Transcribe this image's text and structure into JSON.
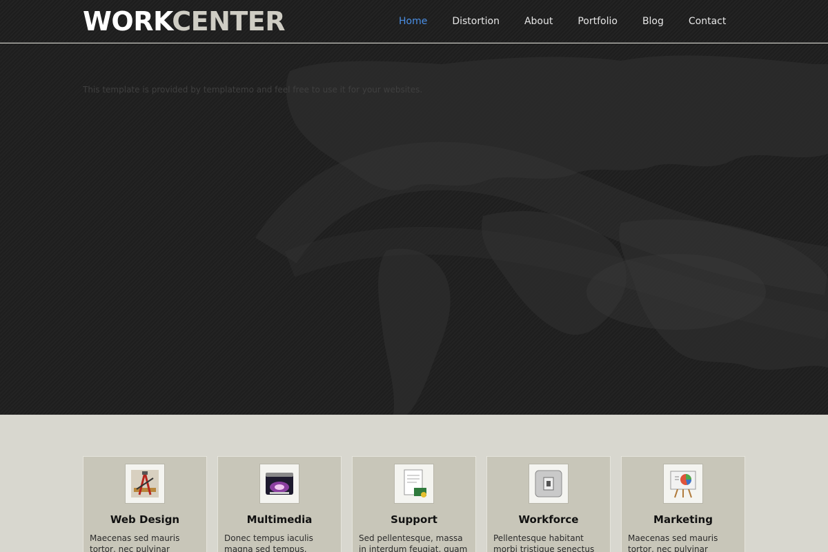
{
  "header": {
    "logo": {
      "part1": "WORK",
      "part2": "CENTER"
    },
    "nav": [
      "Home",
      "Distortion",
      "About",
      "Portfolio",
      "Blog",
      "Contact"
    ],
    "active_nav": "Home"
  },
  "hero": {
    "text": "This template is provided by templatemo and feel free to use it for your websites."
  },
  "services": [
    {
      "title": "Web Design",
      "text": "Maecenas sed mauris tortor, nec pulvinar sapien. Vivamus",
      "icon": "web-design-icon"
    },
    {
      "title": "Multimedia",
      "text": "Donec tempus iaculis magna sed tempus. Pellentesque",
      "icon": "multimedia-icon"
    },
    {
      "title": "Support",
      "text": "Sed pellentesque, massa in interdum feugiat, quam",
      "icon": "support-icon"
    },
    {
      "title": "Workforce",
      "text": "Pellentesque habitant morbi tristique senectus et netus et",
      "icon": "workforce-icon"
    },
    {
      "title": "Marketing",
      "text": "Maecenas sed mauris tortor, nec pulvinar sapien. Vivamus",
      "icon": "marketing-icon"
    }
  ],
  "colors": {
    "nav_active": "#4a8fe6",
    "header_bg": "#1d1d1d",
    "content_bg": "#d8d7cf",
    "card_bg": "#c8c6b9"
  }
}
